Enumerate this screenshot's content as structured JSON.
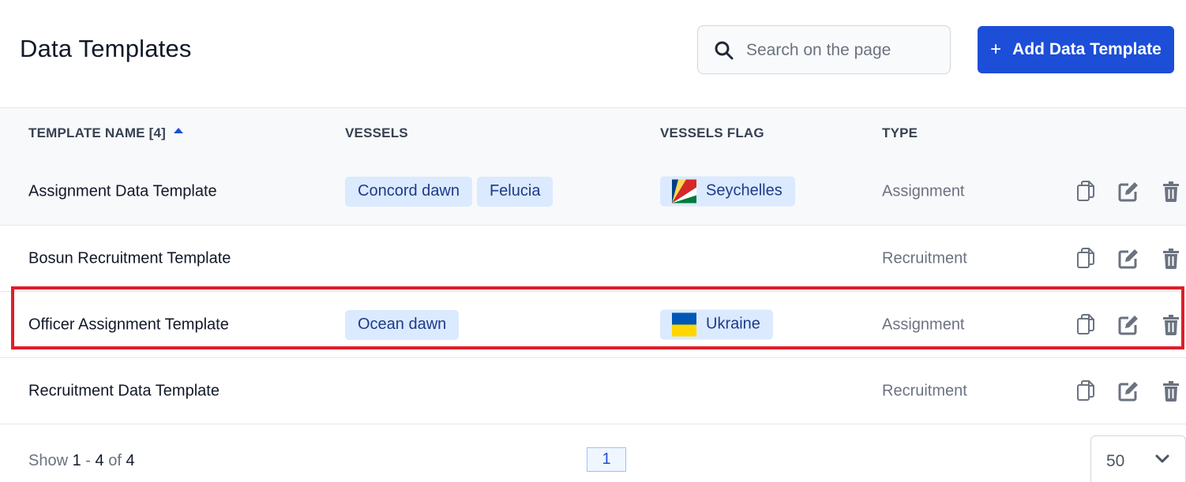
{
  "header": {
    "title": "Data Templates",
    "search_placeholder": "Search on the page",
    "search_value": "",
    "add_button_label": "Add Data Template",
    "add_button_icon": "plus-icon",
    "search_icon": "search-icon"
  },
  "colors": {
    "accent": "#1d4ed8",
    "chip_bg": "#dbeafe",
    "chip_text": "#1e3a8a",
    "highlight": "#e11d2a"
  },
  "table": {
    "columns": {
      "name": "TEMPLATE NAME [4]",
      "vessels": "VESSELS",
      "flag": "VESSELS FLAG",
      "type": "TYPE"
    },
    "sort": {
      "column": "name",
      "direction": "ascending"
    },
    "rows": [
      {
        "name": "Assignment Data Template",
        "vessels": [
          "Concord dawn",
          "Felucia"
        ],
        "flag": "Seychelles",
        "type": "Assignment",
        "actions": [
          "copy-icon",
          "edit-icon",
          "trash-icon"
        ]
      },
      {
        "name": "Bosun Recruitment Template",
        "vessels": [],
        "flag": "",
        "type": "Recruitment",
        "actions": [
          "copy-icon",
          "edit-icon",
          "trash-icon"
        ]
      },
      {
        "name": "Officer Assignment Template",
        "vessels": [
          "Ocean dawn"
        ],
        "flag": "Ukraine",
        "type": "Assignment",
        "highlighted": true,
        "actions": [
          "copy-icon",
          "edit-icon",
          "trash-icon"
        ]
      },
      {
        "name": "Recruitment Data Template",
        "vessels": [],
        "flag": "",
        "type": "Recruitment",
        "actions": [
          "copy-icon",
          "edit-icon",
          "trash-icon"
        ]
      }
    ]
  },
  "footer": {
    "show_label": "Show",
    "range_start": "1",
    "range_sep": "-",
    "range_end": "4",
    "of_label": "of",
    "total": "4",
    "current_page": "1",
    "page_size": "50"
  }
}
